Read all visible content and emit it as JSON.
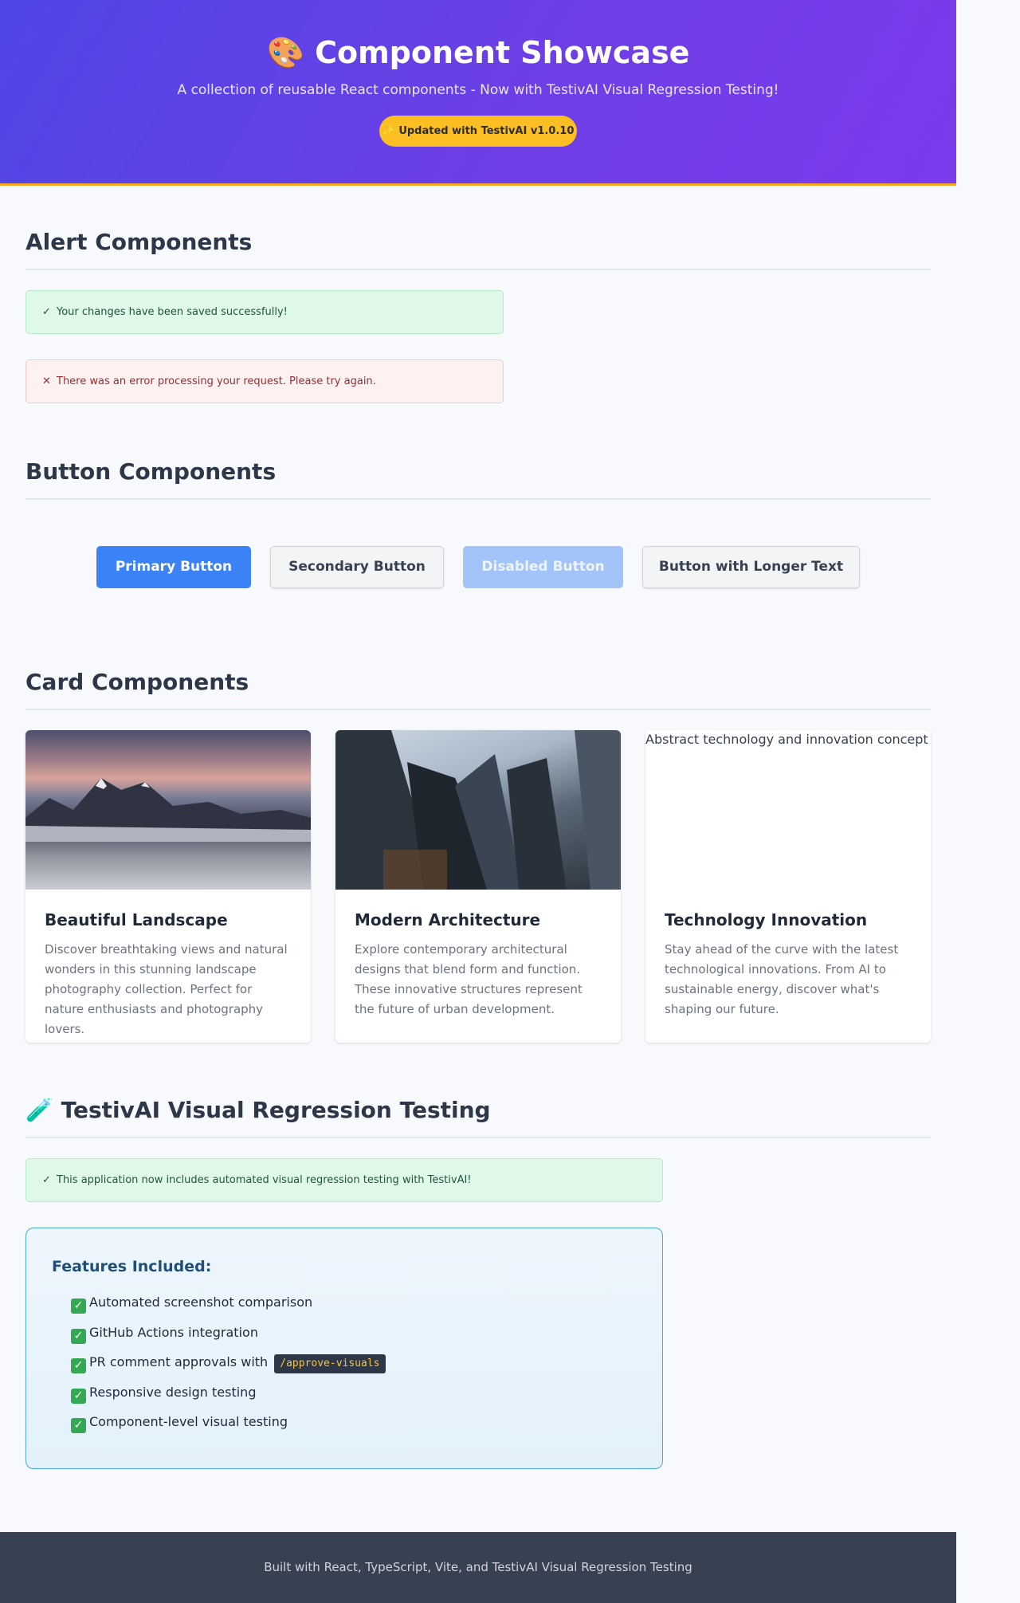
{
  "header": {
    "icon": "palette-icon",
    "title": "Component Showcase",
    "subtitle": "A collection of reusable React components - Now with TestivAI Visual Regression Testing!",
    "badge": "✨ Updated with TestivAI v1.0.10",
    "gradient_from": "#4f46e5",
    "gradient_to": "#7c3aed",
    "badge_color": "#fbbf24"
  },
  "alerts_section": {
    "title": "Alert Components",
    "success": {
      "icon": "check-icon",
      "text": "Your changes have been saved successfully!"
    },
    "error": {
      "icon": "close-icon",
      "text": "There was an error processing your request. Please try again."
    }
  },
  "buttons_section": {
    "title": "Button Components",
    "primary": "Primary Button",
    "secondary": "Secondary Button",
    "disabled": "Disabled Button",
    "longer": "Button with Longer Text"
  },
  "cards_section": {
    "title": "Card Components",
    "cards": [
      {
        "title": "Beautiful Landscape",
        "description": "Discover breathtaking views and natural wonders in this stunning landscape photography collection. Perfect for nature enthusiasts and photography lovers."
      },
      {
        "title": "Modern Architecture",
        "description": "Explore contemporary architectural designs that blend form and function. These innovative structures represent the future of urban development."
      },
      {
        "image_alt": "Abstract technology and innovation concept",
        "title": "Technology Innovation",
        "description": "Stay ahead of the curve with the latest technological innovations. From AI to sustainable energy, discover what's shaping our future."
      }
    ]
  },
  "testivai_section": {
    "icon": "test-tube-icon",
    "title": "TestivAI Visual Regression Testing",
    "alert": {
      "icon": "check-icon",
      "text": "This application now includes automated visual regression testing with TestivAI!"
    },
    "features_title": "Features Included:",
    "features": [
      "Automated screenshot comparison",
      "GitHub Actions integration",
      "PR comment approvals with",
      "Responsive design testing",
      "Component-level visual testing"
    ],
    "code": "/approve-visuals"
  },
  "footer": {
    "text": "Built with React, TypeScript, Vite, and TestivAI Visual Regression Testing"
  }
}
